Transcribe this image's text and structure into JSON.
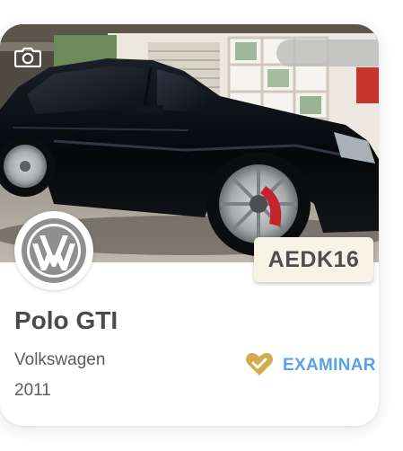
{
  "card": {
    "plate": "AEDK16",
    "model": "Polo GTI",
    "make": "Volkswagen",
    "year": "2011",
    "action_label": "EXAMINAR"
  },
  "icons": {
    "photo": "camera-icon",
    "logo": "volkswagen-logo",
    "favorite": "heart-check-icon"
  },
  "colors": {
    "action": "#5aa0ea",
    "heart": "#d6aa4e",
    "plate_bg": "#f8f3e7",
    "text_dark": "#4a4a4a"
  }
}
